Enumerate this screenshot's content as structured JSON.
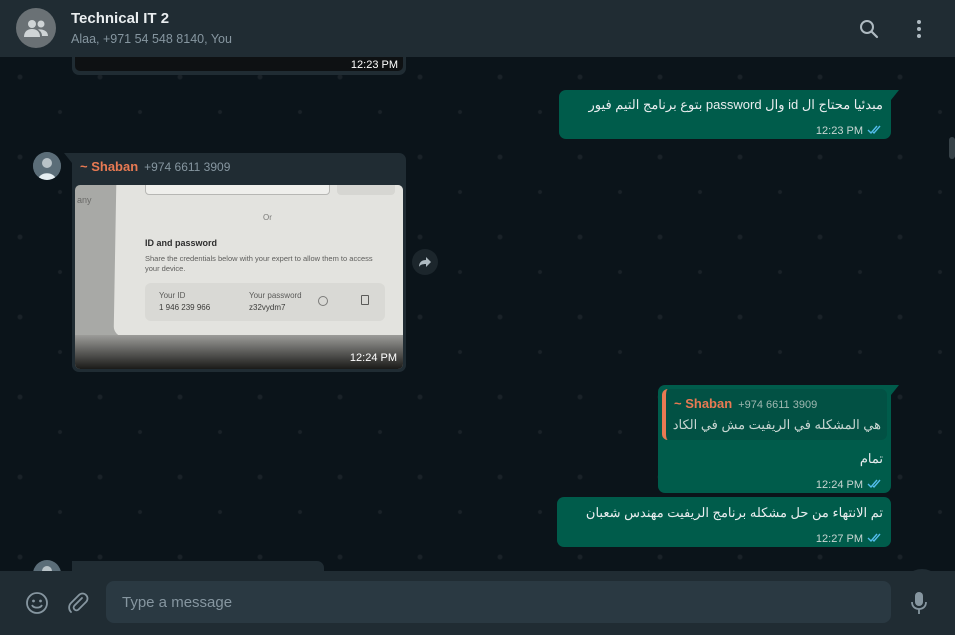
{
  "header": {
    "title": "Technical IT 2",
    "subtitle": "Alaa, +971 54 548 8140, You"
  },
  "messages": {
    "top_partial": {
      "time": "12:23 PM"
    },
    "msg1": {
      "text": "مبدئيا محتاج ال id وال password بتوع برنامج التيم فيور",
      "time": "12:23 PM"
    },
    "image_msg": {
      "sender": "~ Shaban",
      "phone": "+974 6611 3909",
      "time": "12:24 PM",
      "screen": {
        "any": "any",
        "or": "Or",
        "heading": "ID and password",
        "desc": "Share the credentials below with your expert to allow them to access your device.",
        "your_id_label": "Your ID",
        "your_id_value": "1 946 239 966",
        "your_password_label": "Your password",
        "your_password_value": "z32vydm7"
      }
    },
    "reply_msg": {
      "quote_sender": "~ Shaban",
      "quote_phone": "+974 6611 3909",
      "quote_text": "هي المشكله في الريفيت مش في الكاد",
      "text": "تمام",
      "time": "12:24 PM"
    },
    "msg3": {
      "text": "تم الانتهاء من حل مشكله برنامج الريفيت مهندس شعبان",
      "time": "12:27 PM"
    }
  },
  "composer": {
    "placeholder": "Type a message"
  },
  "colors": {
    "accent_sender": "#e87a53",
    "tick_read": "#53bdeb",
    "outgoing_bubble": "#005c4b"
  },
  "icons": [
    "group-avatar-icon",
    "search-icon",
    "menu-icon",
    "forward-icon",
    "chevron-down-icon",
    "emoji-icon",
    "attach-icon",
    "mic-icon"
  ]
}
